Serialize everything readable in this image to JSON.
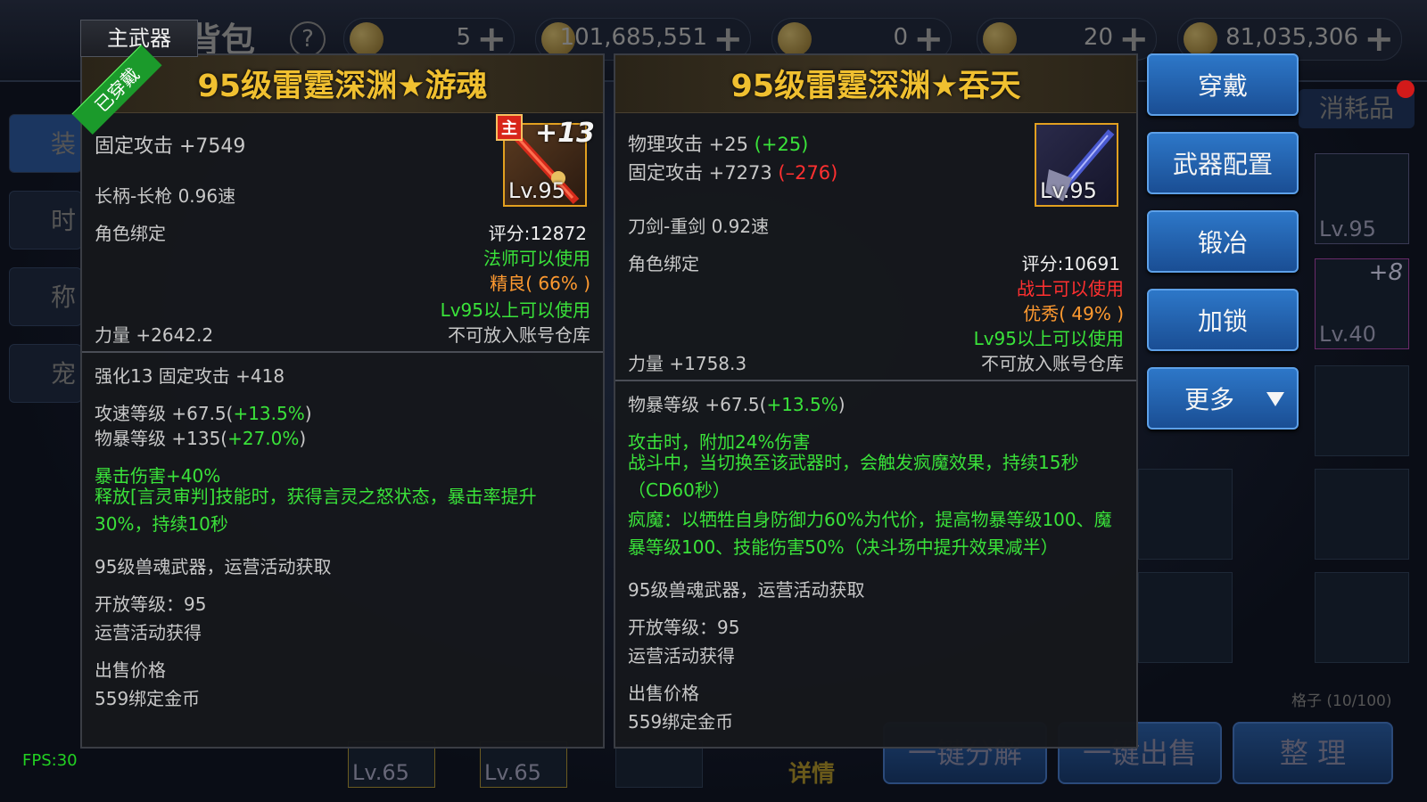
{
  "topbar": {
    "title": "背包",
    "currencies": [
      {
        "icon": "coin-icon",
        "value": "5"
      },
      {
        "icon": "scroll-icon",
        "value": "101,685,551"
      },
      {
        "icon": "scroll-icon",
        "value": "0"
      },
      {
        "icon": "coin-icon",
        "value": "20"
      },
      {
        "icon": "gold-coin-icon",
        "value": "81,035,306"
      }
    ]
  },
  "left_tabs": [
    "装",
    "时",
    "称",
    "宠"
  ],
  "consumables_tab": "消耗品",
  "inventory": {
    "slots": [
      {
        "level": "Lv.95"
      },
      {
        "level": "Lv.40",
        "plus": "+8"
      }
    ],
    "grid_count": "格子 (10/100)",
    "bottom_slots": [
      "Lv.65",
      "Lv.65"
    ],
    "detail_tab": "详情"
  },
  "bottom_buttons": [
    "一键分解",
    "一键出售",
    "整 理"
  ],
  "fps": "FPS:30",
  "equipped_tag": "主武器",
  "equipped_ribbon": "已穿戴",
  "left_item": {
    "title": "95级雷霆深渊★游魂",
    "icon_level": "Lv.95",
    "enhance": "+13",
    "main_badge": "主",
    "fixed_attack": "固定攻击 +7549",
    "weapon_type": "长柄-长枪   0.96速",
    "bind": "角色绑定",
    "score": "评分:12872",
    "usable_by": "法师可以使用",
    "quality": "精良( 66% )",
    "level_req": "Lv95以上可以使用",
    "strength": "力量 +2642.2",
    "storage": "不可放入账号仓库",
    "enhance_bonus": "强化13 固定攻击 +418",
    "attack_speed": "攻速等级 +67.5(",
    "attack_speed_pct": "+13.5%",
    "attack_speed_close": ")",
    "crit_level": "物暴等级 +135(",
    "crit_level_pct": "+27.0%",
    "crit_level_close": ")",
    "crit_damage": "暴击伤害+40%",
    "skill_effect": "释放[言灵审判]技能时，获得言灵之怒状态，暴击率提升30%，持续10秒",
    "source": "95级兽魂武器，运营活动获取",
    "open_level": "开放等级：95",
    "obtain": "运营活动获得",
    "sell_label": "出售价格",
    "sell_price": "559绑定金币"
  },
  "right_item": {
    "title": "95级雷霆深渊★吞天",
    "icon_level": "Lv.95",
    "phys_attack": "物理攻击 +25 ",
    "phys_attack_diff": "(+25)",
    "fixed_attack": "固定攻击 +7273 ",
    "fixed_attack_diff": "(–276)",
    "weapon_type": "刀剑-重剑   0.92速",
    "bind": "角色绑定",
    "score": "评分:10691",
    "usable_by": "战士可以使用",
    "quality": "优秀( 49% )",
    "level_req": "Lv95以上可以使用",
    "strength": "力量 +1758.3",
    "storage": "不可放入账号仓库",
    "crit_level": "物暴等级 +67.5(",
    "crit_level_pct": "+13.5%",
    "crit_level_close": ")",
    "effect1": "攻击时，附加24%伤害",
    "effect2": "战斗中，当切换至该武器时，会触发疯魔效果，持续15秒（CD60秒）",
    "effect3": "疯魔：以牺牲自身防御力60%为代价，提高物暴等级100、魔暴等级100、技能伤害50%（决斗场中提升效果减半）",
    "source": "95级兽魂武器，运营活动获取",
    "open_level": "开放等级：95",
    "obtain": "运营活动获得",
    "sell_label": "出售价格",
    "sell_price": "559绑定金币"
  },
  "actions": [
    "穿戴",
    "武器配置",
    "锻冶",
    "加锁",
    "更多"
  ]
}
